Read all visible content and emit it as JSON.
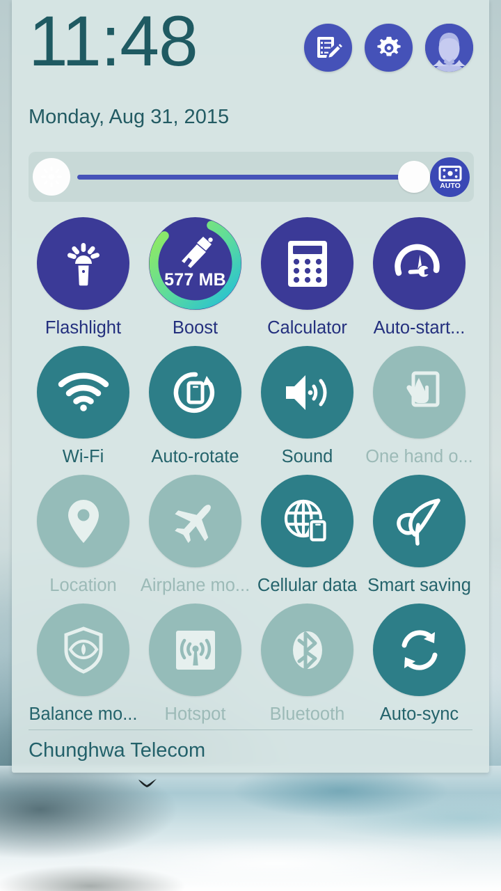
{
  "status_panel": {
    "clock": "11:48",
    "date": "Monday, Aug 31, 2015",
    "header_actions": [
      {
        "name": "quick-settings-edit",
        "icon": "edit-note-icon",
        "label": "Edit quick settings"
      },
      {
        "name": "settings",
        "icon": "gear-icon",
        "label": "Settings"
      },
      {
        "name": "user-profile",
        "icon": "avatar-icon",
        "label": "User profile"
      }
    ],
    "brightness": {
      "icon": "brightness-icon",
      "value": 100,
      "auto_label": "AUTO",
      "auto_icon": "auto-brightness-icon"
    },
    "toggles": [
      {
        "label": "Flashlight",
        "icon": "flashlight-icon",
        "state": "app"
      },
      {
        "label": "Boost",
        "icon": "boost-broom-icon",
        "state": "app",
        "badge": "577 MB"
      },
      {
        "label": "Calculator",
        "icon": "calculator-icon",
        "state": "app"
      },
      {
        "label": "Auto-start...",
        "icon": "auto-start-icon",
        "state": "app"
      },
      {
        "label": "Wi-Fi",
        "icon": "wifi-icon",
        "state": "on"
      },
      {
        "label": "Auto-rotate",
        "icon": "auto-rotate-icon",
        "state": "on"
      },
      {
        "label": "Sound",
        "icon": "sound-icon",
        "state": "on"
      },
      {
        "label": "One hand o...",
        "icon": "one-hand-icon",
        "state": "off"
      },
      {
        "label": "Location",
        "icon": "location-pin-icon",
        "state": "off"
      },
      {
        "label": "Airplane mo...",
        "icon": "airplane-icon",
        "state": "off"
      },
      {
        "label": "Cellular data",
        "icon": "cellular-data-icon",
        "state": "on"
      },
      {
        "label": "Smart saving",
        "icon": "leaf-icon",
        "state": "on"
      },
      {
        "label": "Balance mo...",
        "icon": "shield-eye-icon",
        "state": "off",
        "label_state": "on"
      },
      {
        "label": "Hotspot",
        "icon": "hotspot-icon",
        "state": "off"
      },
      {
        "label": "Bluetooth",
        "icon": "bluetooth-icon",
        "state": "off"
      },
      {
        "label": "Auto-sync",
        "icon": "auto-sync-icon",
        "state": "on"
      }
    ],
    "carrier": "Chunghwa Telecom"
  },
  "colors": {
    "panel_background": "#d7e5e4",
    "app_tile": "#3b3a97",
    "toggle_on": "#2d7e88",
    "toggle_off": "#95bcb9",
    "accent_blue": "#4552b8",
    "clock_text": "#1f5a62",
    "boost_ring_start": "#8ae86a",
    "boost_ring_end": "#2bc3cf"
  }
}
